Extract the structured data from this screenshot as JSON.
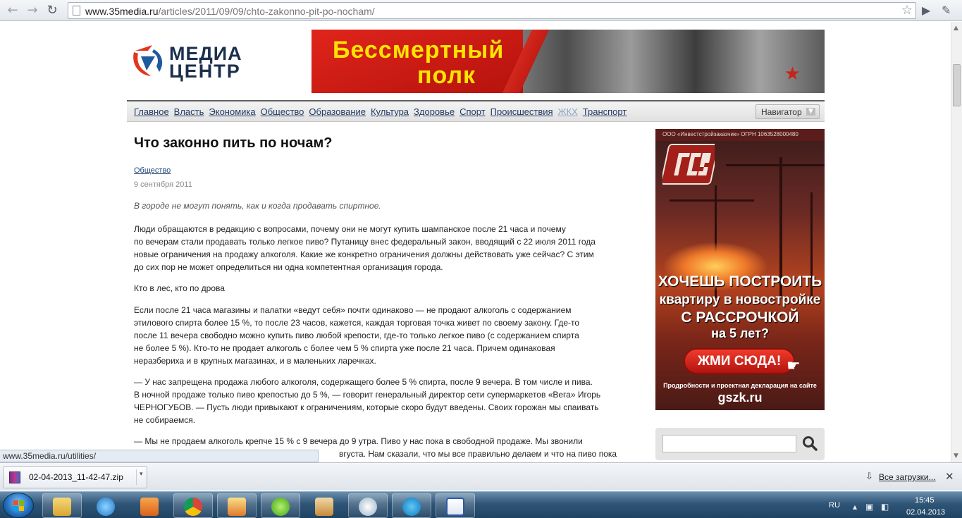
{
  "browser": {
    "url_host": "www.35media.ru",
    "url_path": "/articles/2011/09/09/chto-zakonno-pit-po-nocham/"
  },
  "site": {
    "logo_line1": "МЕДИА",
    "logo_line2": "ЦЕНТР",
    "banner_line1": "Бессмертный",
    "banner_line2": "полк",
    "nav": [
      "Главное",
      "Власть",
      "Экономика",
      "Общество",
      "Образование",
      "Культура",
      "Здоровье",
      "Спорт",
      "Происшествия",
      "ЖКХ",
      "Транспорт"
    ],
    "navigator_label": "Навигатор"
  },
  "article": {
    "title": "Что законно пить по ночам?",
    "category": "Общество",
    "date": "9 сентября 2011",
    "lead": "В городе не могут понять, как и когда продавать спиртное.",
    "p1": [
      "Люди обращаются в редакцию с вопросами, почему они не могут купить шампанское после 21 часа и почему",
      "по вечерам стали продавать только легкое пиво? Путаницу внес федеральный закон, вводящий с 22 июля 2011 года",
      "новые ограничения на продажу алкоголя. Какие же конкретно ограничения должны действовать уже сейчас? С этим",
      "до сих пор не может определиться ни одна компетентная организация города."
    ],
    "p2": "Кто в лес, кто по дрова",
    "p3": [
      "Если после 21 часа магазины и палатки «ведут себя» почти одинаково — не продают алкоголь с содержанием",
      "этилового спирта более 15 %, то после 23 часов, кажется, каждая торговая точка живет по своему закону. Где-то",
      "после 11 вечера свободно можно купить пиво любой крепости, где-то только легкое пиво (с содержанием спирта",
      "не более 5 %). Кто-то не продает алкоголь с более чем 5 % спирта уже после 21 часа. Причем одинаковая",
      "неразбериха и в крупных магазинах, и в маленьких ларечках."
    ],
    "p4": [
      "— У нас запрещена продажа любого алкоголя, содержащего более 5 % спирта, после 9 вечера. В том числе и пива.",
      "В ночной продаже только пиво крепостью до 5 %, — говорит генеральный директор сети супермаркетов «Вега» Игорь",
      "ЧЕРНОГУБОВ. — Пусть люди привыкают к ограничениям, которые скоро будут введены. Своих горожан мы спаивать",
      "не собираемся."
    ],
    "p5": [
      "— Мы не продаем алкоголь крепче 15 % с 9 вечера до 9 утра. Пиво у нас пока в свободной продаже. Мы звонили",
      "вгуста. Нам сказали, что мы все правильно делаем и что на пиво пока"
    ]
  },
  "ad": {
    "company": "ООО «Инвестстройзаказчик»   ОГРН 1063528000480",
    "h1": "ХОЧЕШЬ ПОСТРОИТЬ",
    "h2": "квартиру в новостройке",
    "h3": "С РАССРОЧКОЙ",
    "h4": "на 5 лет?",
    "cta": "ЖМИ СЮДА!",
    "small": "Продробности и проектная декларация на сайте",
    "site": "gszk.ru"
  },
  "search": {
    "value": ""
  },
  "status_url": "www.35media.ru/utilities/",
  "download": {
    "filename": "02-04-2013_11-42-47.zip",
    "all_label": "Все загрузки..."
  },
  "tray": {
    "lang": "RU",
    "time": "15:45",
    "date": "02.04.2013"
  },
  "taskbar_apps": [
    "file-explorer-icon",
    "internet-explorer-icon",
    "media-player-icon",
    "chrome-icon",
    "archive-app-icon",
    "icq-icon",
    "scanner-app-icon",
    "hp-app-icon",
    "skype-icon",
    "word-icon"
  ]
}
